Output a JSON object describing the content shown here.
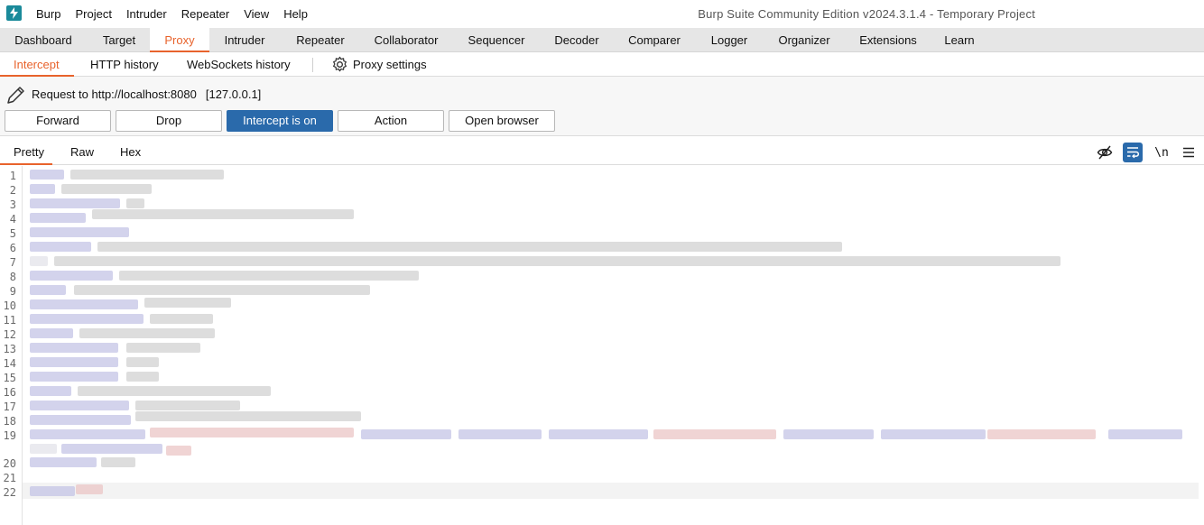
{
  "window": {
    "menu": [
      "Burp",
      "Project",
      "Intruder",
      "Repeater",
      "View",
      "Help"
    ],
    "title": "Burp Suite Community Edition v2024.3.1.4 - Temporary Project"
  },
  "main_tabs": [
    "Dashboard",
    "Target",
    "Proxy",
    "Intruder",
    "Repeater",
    "Collaborator",
    "Sequencer",
    "Decoder",
    "Comparer",
    "Logger",
    "Organizer",
    "Extensions",
    "Learn"
  ],
  "active_main_tab": "Proxy",
  "sub_tabs": [
    "Intercept",
    "HTTP history",
    "WebSockets history"
  ],
  "active_sub_tab": "Intercept",
  "settings_label": "Proxy settings",
  "request": {
    "label": "Request to http://localhost:8080",
    "ip": "[127.0.0.1]"
  },
  "buttons": {
    "forward": "Forward",
    "drop": "Drop",
    "intercept": "Intercept is on",
    "action": "Action",
    "open_browser": "Open browser"
  },
  "view_tabs": [
    "Pretty",
    "Raw",
    "Hex"
  ],
  "active_view_tab": "Pretty",
  "toolbar": {
    "newline_label": "\\n"
  },
  "editor": {
    "line_numbers": [
      "1",
      "2",
      "3",
      "4",
      "5",
      "6",
      "7",
      "8",
      "9",
      "10",
      "11",
      "12",
      "13",
      "14",
      "15",
      "16",
      "17",
      "18",
      "19",
      "20",
      "21",
      "22"
    ]
  },
  "colors": {
    "accent": "#e8632c",
    "primary_button": "#2a6aab",
    "logo": "#1a8a9a"
  }
}
